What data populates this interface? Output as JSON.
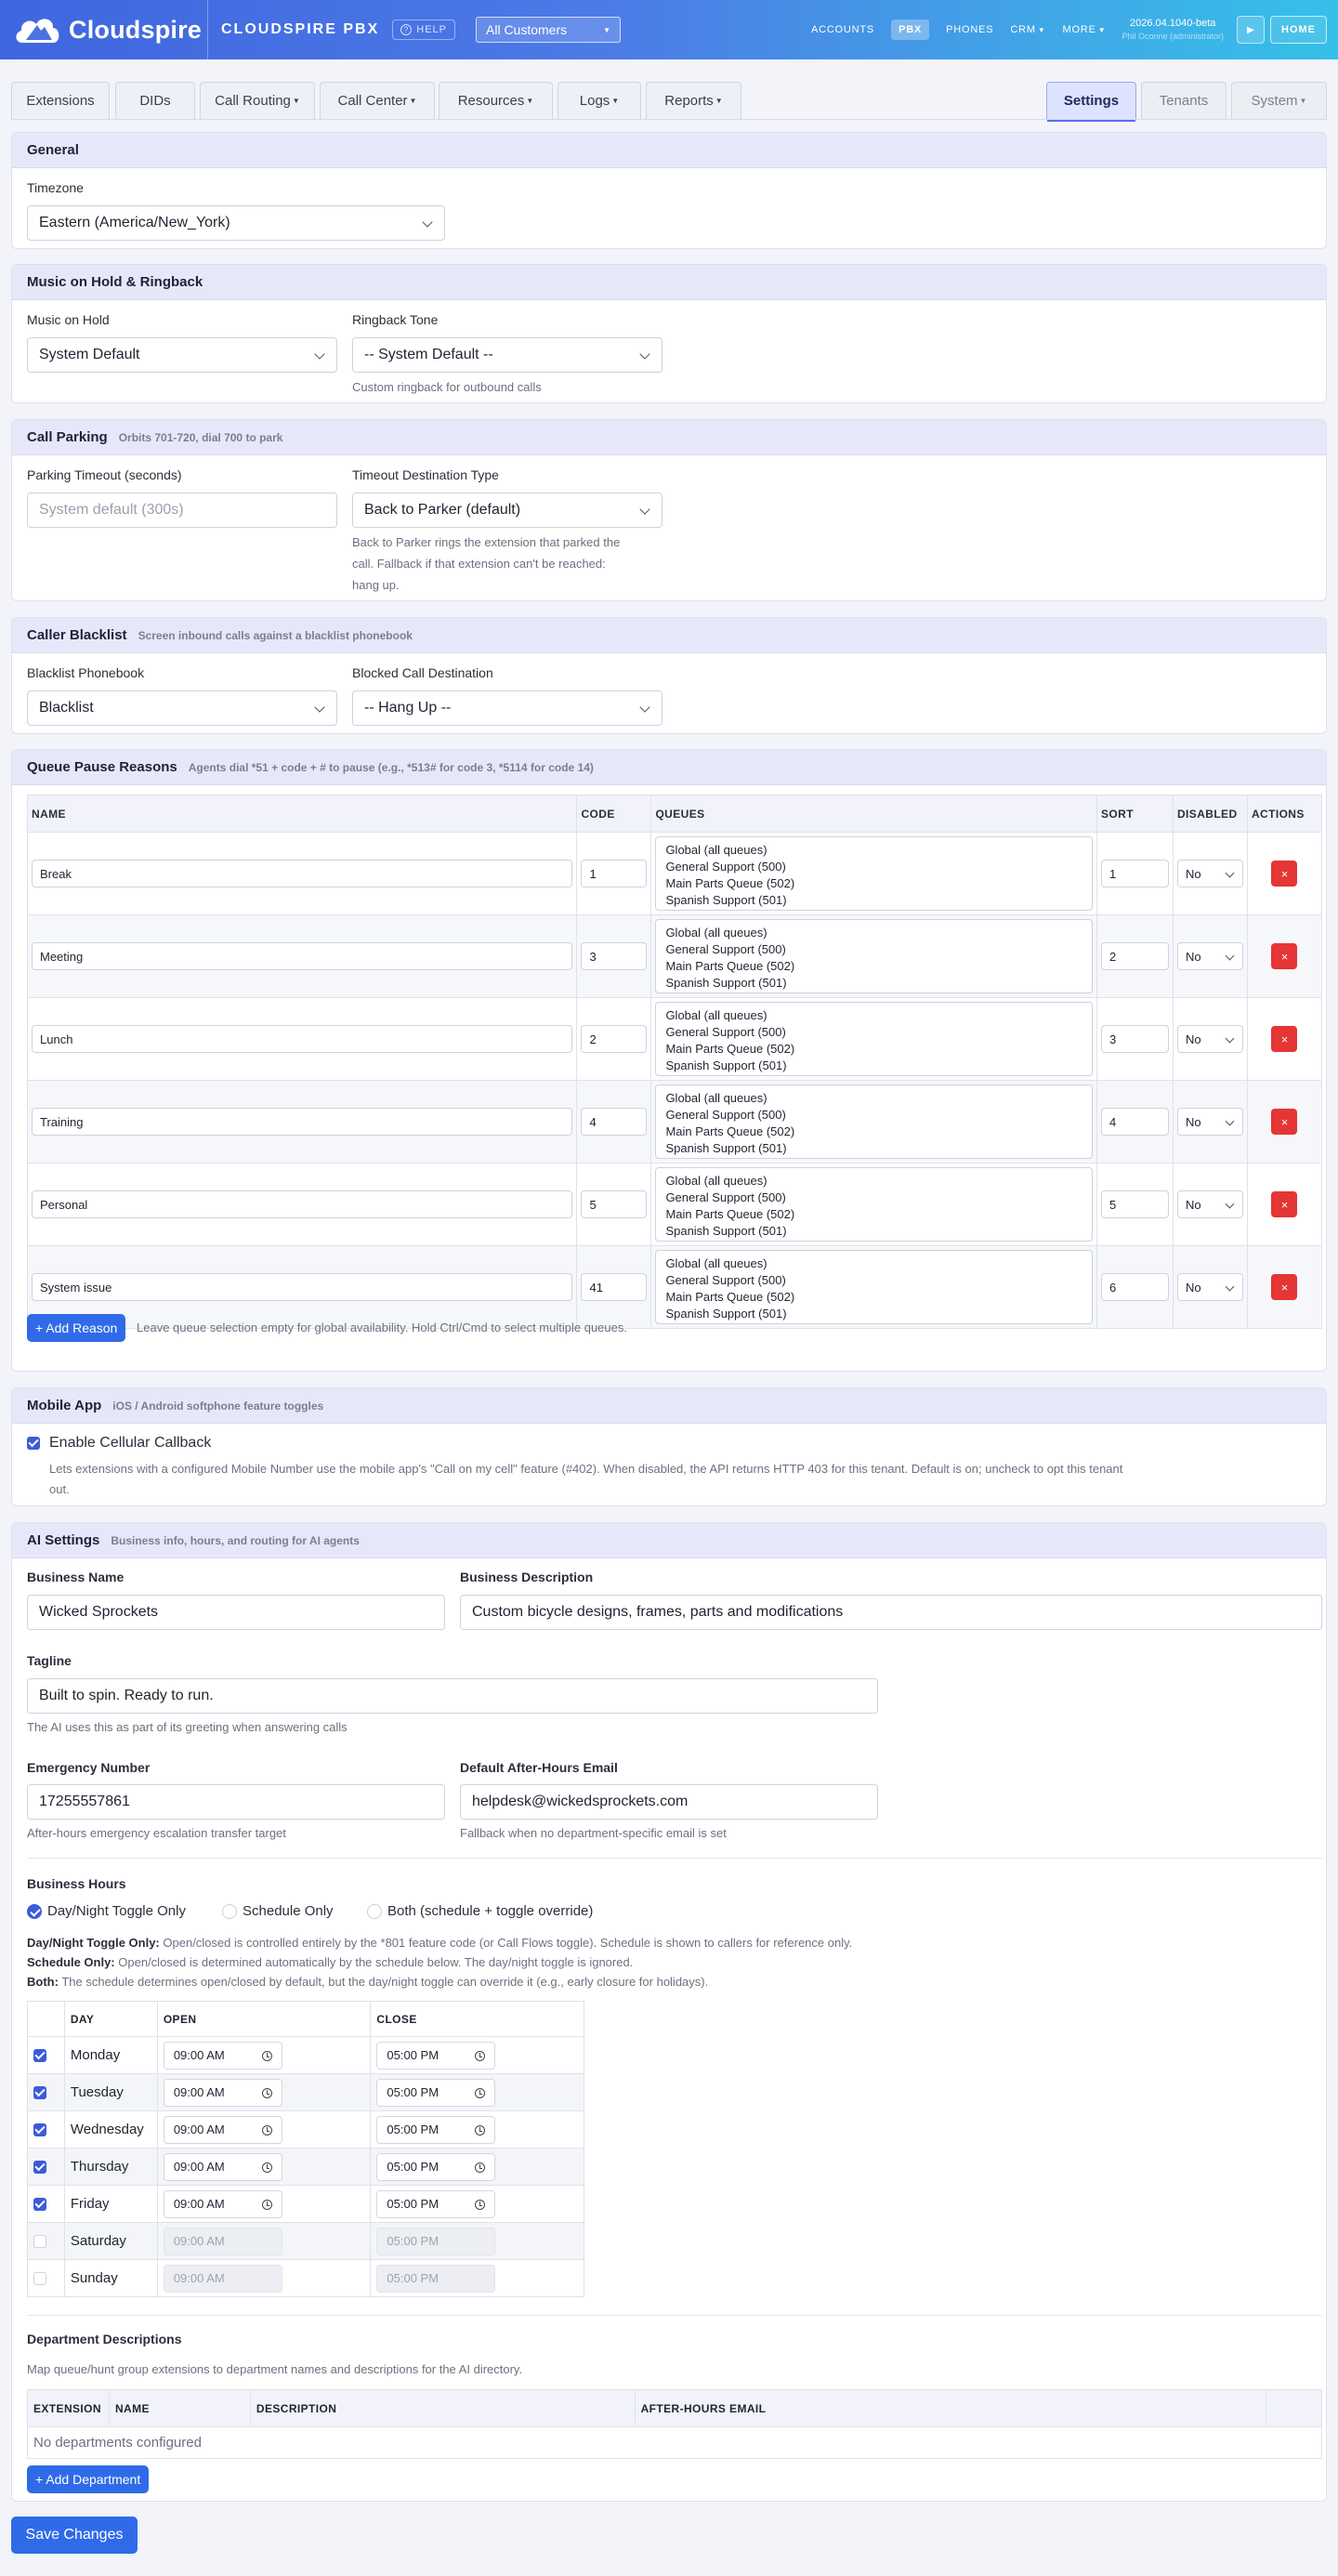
{
  "topbar": {
    "logo_text": "Cloudspire",
    "brand": "CLOUDSPIRE PBX",
    "help": "HELP",
    "customer_select": "All Customers",
    "nav": [
      "ACCOUNTS",
      "PBX",
      "PHONES",
      "CRM",
      "MORE"
    ],
    "version": "2026.04.1040-beta",
    "user": "Phil Oconne (administrator)",
    "home": "HOME"
  },
  "tabs": {
    "left": [
      "Extensions",
      "DIDs",
      "Call Routing",
      "Call Center",
      "Resources",
      "Logs",
      "Reports"
    ],
    "right": [
      "Settings",
      "Tenants",
      "System"
    ]
  },
  "general": {
    "title": "General",
    "timezone_label": "Timezone",
    "timezone_value": "Eastern (America/New_York)"
  },
  "moh": {
    "title": "Music on Hold & Ringback",
    "moh_label": "Music on Hold",
    "moh_value": "System Default",
    "ringback_label": "Ringback Tone",
    "ringback_value": "-- System Default --",
    "ringback_help": "Custom ringback for outbound calls"
  },
  "parking": {
    "title": "Call Parking",
    "hint": "Orbits 701-720, dial 700 to park",
    "timeout_label": "Parking Timeout (seconds)",
    "timeout_placeholder": "System default (300s)",
    "dest_label": "Timeout Destination Type",
    "dest_value": "Back to Parker (default)",
    "dest_help_1": "Back to Parker rings the extension that parked the",
    "dest_help_2": "call. Fallback if that extension can't be reached:",
    "dest_help_3": "hang up."
  },
  "blacklist": {
    "title": "Caller Blacklist",
    "hint": "Screen inbound calls against a blacklist phonebook",
    "phonebook_label": "Blacklist Phonebook",
    "phonebook_value": "Blacklist",
    "dest_label": "Blocked Call Destination",
    "dest_value": "-- Hang Up --"
  },
  "queue_pause": {
    "title": "Queue Pause Reasons",
    "hint": "Agents dial *51 + code + # to pause (e.g., *513# for code 3, *5114 for code 14)",
    "columns": [
      "NAME",
      "CODE",
      "QUEUES",
      "SORT",
      "DISABLED",
      "ACTIONS"
    ],
    "queue_options": [
      "Global (all queues)",
      "General Support (500)",
      "Main Parts Queue (502)",
      "Spanish Support (501)"
    ],
    "rows": [
      {
        "name": "Break",
        "code": "1",
        "sort": "1",
        "disabled": "No"
      },
      {
        "name": "Meeting",
        "code": "3",
        "sort": "2",
        "disabled": "No"
      },
      {
        "name": "Lunch",
        "code": "2",
        "sort": "3",
        "disabled": "No"
      },
      {
        "name": "Training",
        "code": "4",
        "sort": "4",
        "disabled": "No"
      },
      {
        "name": "Personal",
        "code": "5",
        "sort": "5",
        "disabled": "No"
      },
      {
        "name": "System issue",
        "code": "41",
        "sort": "6",
        "disabled": "No"
      }
    ],
    "delete_glyph": "×",
    "add_label": "+ Add Reason",
    "add_help": "Leave queue selection empty for global availability. Hold Ctrl/Cmd to select multiple queues."
  },
  "mobile": {
    "title": "Mobile App",
    "hint": "iOS / Android softphone feature toggles",
    "callback_label": "Enable Cellular Callback",
    "callback_help_1": "Lets extensions with a configured Mobile Number use the mobile app's \"Call on my cell\" feature (#402). When disabled, the API returns HTTP 403 for this tenant. Default is on; uncheck to opt this tenant",
    "callback_help_2": "out."
  },
  "ai": {
    "title": "AI Settings",
    "hint": "Business info, hours, and routing for AI agents",
    "business_name_label": "Business Name",
    "business_name": "Wicked Sprockets",
    "business_desc_label": "Business Description",
    "business_desc": "Custom bicycle designs, frames, parts and modifications",
    "tagline_label": "Tagline",
    "tagline": "Built to spin. Ready to run.",
    "tagline_help": "The AI uses this as part of its greeting when answering calls",
    "emergency_label": "Emergency Number",
    "emergency": "17255557861",
    "emergency_help": "After-hours emergency escalation transfer target",
    "email_label": "Default After-Hours Email",
    "email": "helpdesk@wickedsprockets.com",
    "email_help": "Fallback when no department-specific email is set",
    "hours_label": "Business Hours",
    "modes": [
      "Day/Night Toggle Only",
      "Schedule Only",
      "Both (schedule + toggle override)"
    ],
    "mode_desc": [
      {
        "term": "Day/Night Toggle Only:",
        "text": "Open/closed is controlled entirely by the *801 feature code (or Call Flows toggle). Schedule is shown to callers for reference only."
      },
      {
        "term": "Schedule Only:",
        "text": "Open/closed is determined automatically by the schedule below. The day/night toggle is ignored."
      },
      {
        "term": "Both:",
        "text": "The schedule determines open/closed by default, but the day/night toggle can override it (e.g., early closure for holidays)."
      }
    ],
    "hours_columns": [
      "DAY",
      "OPEN",
      "CLOSE"
    ],
    "hours": [
      {
        "day": "Monday",
        "open": "09:00 AM",
        "close": "05:00 PM",
        "enabled": true
      },
      {
        "day": "Tuesday",
        "open": "09:00 AM",
        "close": "05:00 PM",
        "enabled": true
      },
      {
        "day": "Wednesday",
        "open": "09:00 AM",
        "close": "05:00 PM",
        "enabled": true
      },
      {
        "day": "Thursday",
        "open": "09:00 AM",
        "close": "05:00 PM",
        "enabled": true
      },
      {
        "day": "Friday",
        "open": "09:00 AM",
        "close": "05:00 PM",
        "enabled": true
      },
      {
        "day": "Saturday",
        "open": "09:00 AM",
        "close": "05:00 PM",
        "enabled": false
      },
      {
        "day": "Sunday",
        "open": "09:00 AM",
        "close": "05:00 PM",
        "enabled": false
      }
    ],
    "dept_label": "Department Descriptions",
    "dept_help": "Map queue/hunt group extensions to department names and descriptions for the AI directory.",
    "dept_columns": [
      "EXTENSION",
      "NAME",
      "DESCRIPTION",
      "AFTER-HOURS EMAIL"
    ],
    "dept_empty": "No departments configured",
    "add_dept": "+ Add Department"
  },
  "save": "Save Changes",
  "colors": {
    "accent": "#2f6be8",
    "danger": "#e53535",
    "header_band": "#e6e8fa"
  }
}
